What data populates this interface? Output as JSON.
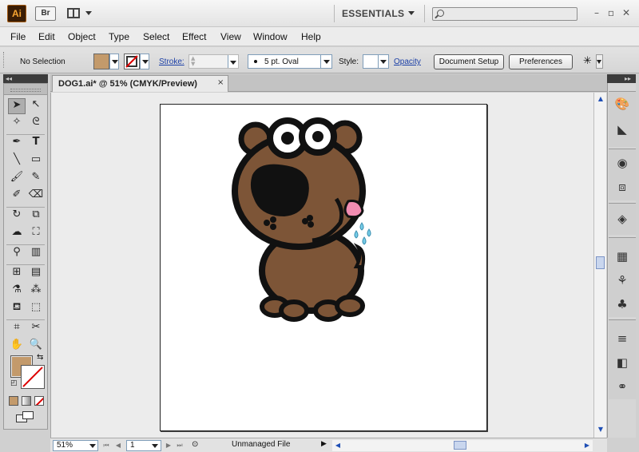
{
  "app": {
    "logo": "Ai",
    "bridge_label": "Br",
    "workspace": "ESSENTIALS",
    "search_placeholder": ""
  },
  "menu": [
    "File",
    "Edit",
    "Object",
    "Type",
    "Select",
    "Effect",
    "View",
    "Window",
    "Help"
  ],
  "control": {
    "selection_status": "No Selection",
    "fill_color": "#c39a6b",
    "stroke_label": "Stroke:",
    "stroke_value": "",
    "brush_label": "5 pt. Oval",
    "style_label": "Style:",
    "opacity_label": "Opacity",
    "document_setup_label": "Document Setup",
    "preferences_label": "Preferences"
  },
  "document": {
    "tab_title": "DOG1.ai* @ 51% (CMYK/Preview)",
    "close_glyph": "×"
  },
  "status": {
    "zoom": "51%",
    "page": "1",
    "info": "Unmanaged File"
  },
  "colors": {
    "fill": "#c39a6b",
    "dog_body": "#7d5537",
    "outline": "#111111",
    "tongue": "#f28db2",
    "drops": "#77cde8"
  }
}
